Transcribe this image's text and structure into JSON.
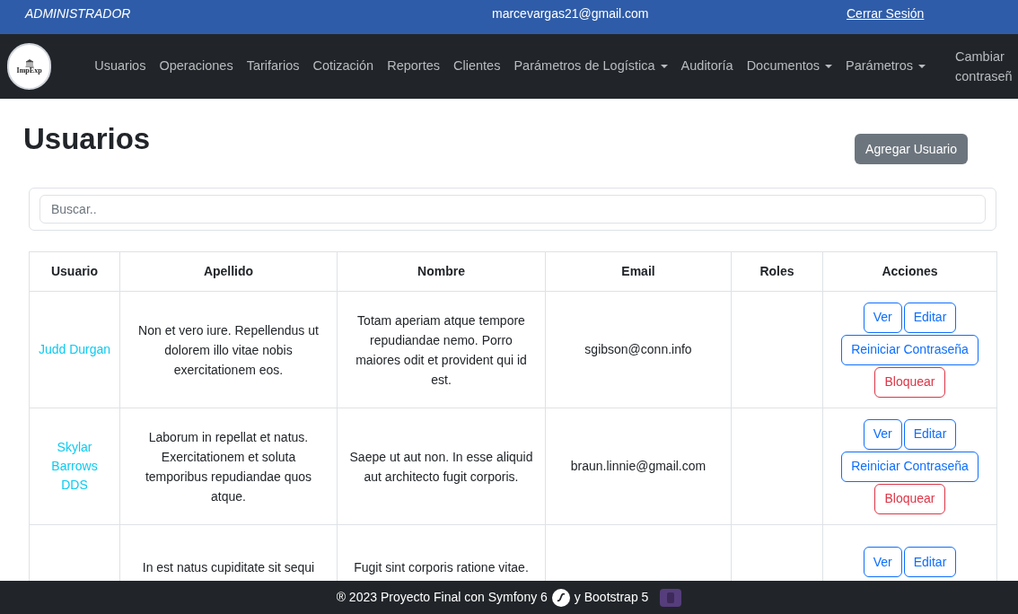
{
  "top_bar": {
    "role": "ADMINISTRADOR",
    "email": "marcevargas21@gmail.com",
    "logout": "Cerrar Sesión"
  },
  "navbar": {
    "logo": "ImpExp",
    "items": [
      {
        "label": "Usuarios",
        "dropdown": false
      },
      {
        "label": "Operaciones",
        "dropdown": false
      },
      {
        "label": "Tarifarios",
        "dropdown": false
      },
      {
        "label": "Cotización",
        "dropdown": false
      },
      {
        "label": "Reportes",
        "dropdown": false
      },
      {
        "label": "Clientes",
        "dropdown": false
      },
      {
        "label": "Parámetros de Logística",
        "dropdown": true
      },
      {
        "label": "Auditoría",
        "dropdown": false
      },
      {
        "label": "Documentos",
        "dropdown": true
      },
      {
        "label": "Parámetros",
        "dropdown": true
      },
      {
        "label": "Cambiar contraseñ",
        "dropdown": false
      }
    ]
  },
  "page": {
    "title": "Usuarios",
    "add_button": "Agregar Usuario"
  },
  "search": {
    "placeholder": "Buscar.."
  },
  "table": {
    "columns": [
      "Usuario",
      "Apellido",
      "Nombre",
      "Email",
      "Roles",
      "Acciones"
    ],
    "rows": [
      {
        "usuario": "Judd Durgan",
        "apellido": "Non et vero iure. Repellendus ut dolorem illo vitae nobis exercitationem eos.",
        "nombre": "Totam aperiam atque tempore repudiandae nemo. Porro maiores odit et provident qui id est.",
        "email": "sgibson@conn.info",
        "actions": [
          {
            "kind": "primary",
            "label": "Ver"
          },
          {
            "kind": "primary",
            "label": "Editar"
          },
          {
            "kind": "primary",
            "label": "Reiniciar Contraseña"
          },
          {
            "kind": "danger",
            "label": "Bloquear"
          }
        ]
      },
      {
        "usuario": "Skylar Barrows DDS",
        "apellido": "Laborum in repellat et natus. Exercitationem et soluta temporibus repudiandae quos atque.",
        "nombre": "Saepe ut aut non. In esse aliquid aut architecto fugit corporis.",
        "email": "braun.linnie@gmail.com",
        "actions": [
          {
            "kind": "primary",
            "label": "Ver"
          },
          {
            "kind": "primary",
            "label": "Editar"
          },
          {
            "kind": "primary",
            "label": "Reiniciar Contraseña"
          },
          {
            "kind": "danger",
            "label": "Bloquear"
          }
        ]
      },
      {
        "usuario": "",
        "apellido": "In est natus cupiditate sit sequi",
        "nombre": "Fugit sint corporis ratione vitae.",
        "email": "",
        "actions": [
          {
            "kind": "primary",
            "label": "Ver"
          },
          {
            "kind": "primary",
            "label": "Editar"
          }
        ]
      }
    ]
  },
  "footer": {
    "text_before": "® 2023 Proyecto Final con Symfony 6",
    "text_after": "y Bootstrap 5"
  }
}
